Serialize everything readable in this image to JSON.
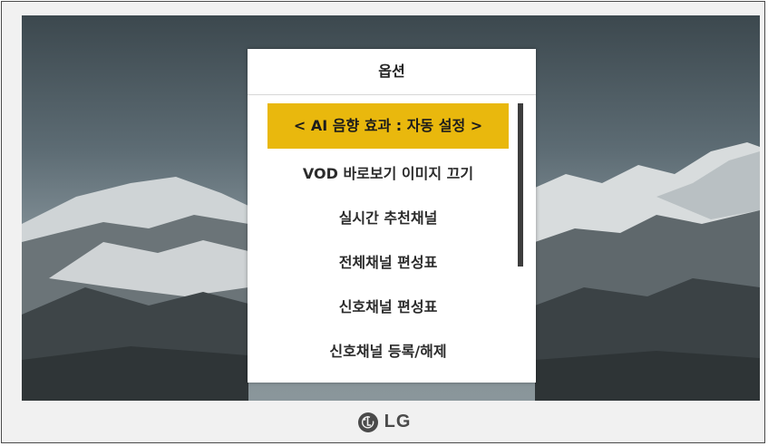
{
  "options_panel": {
    "title": "옵션",
    "items": [
      {
        "label": "< AI 음향 효과 : 자동 설정 >",
        "selected": true
      },
      {
        "label": "VOD 바로보기 이미지 끄기",
        "selected": false
      },
      {
        "label": "실시간 추천채널",
        "selected": false
      },
      {
        "label": "전체채널 편성표",
        "selected": false
      },
      {
        "label": "신호채널 편성표",
        "selected": false
      },
      {
        "label": "신호채널 등록/해제",
        "selected": false
      }
    ],
    "highlight_color": "#e9b80d"
  },
  "brand": {
    "name": "LG",
    "icon": "lg-logo-icon"
  }
}
